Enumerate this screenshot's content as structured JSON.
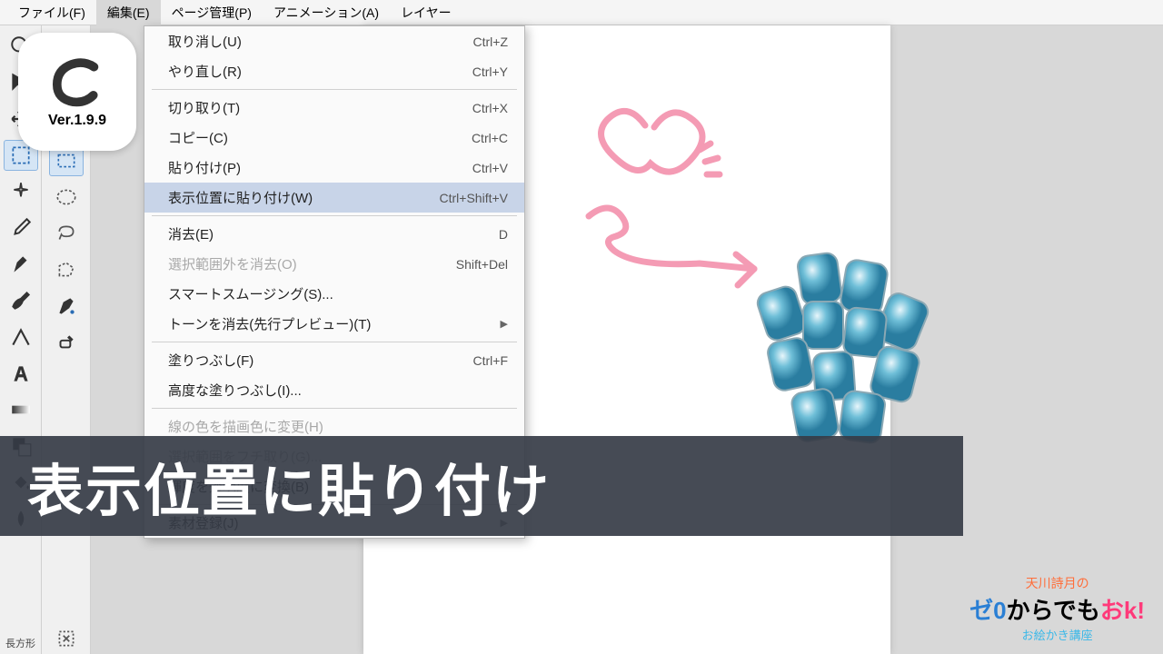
{
  "menubar": [
    {
      "label": "ファイル(F)"
    },
    {
      "label": "編集(E)",
      "active": true
    },
    {
      "label": "ページ管理(P)"
    },
    {
      "label": "アニメーション(A)"
    },
    {
      "label": "レイヤー"
    }
  ],
  "logo": {
    "version": "Ver.1.9.9"
  },
  "dropdown": [
    {
      "type": "item",
      "label": "取り消し(U)",
      "shortcut": "Ctrl+Z"
    },
    {
      "type": "item",
      "label": "やり直し(R)",
      "shortcut": "Ctrl+Y"
    },
    {
      "type": "sep"
    },
    {
      "type": "item",
      "label": "切り取り(T)",
      "shortcut": "Ctrl+X"
    },
    {
      "type": "item",
      "label": "コピー(C)",
      "shortcut": "Ctrl+C"
    },
    {
      "type": "item",
      "label": "貼り付け(P)",
      "shortcut": "Ctrl+V"
    },
    {
      "type": "item",
      "label": "表示位置に貼り付け(W)",
      "shortcut": "Ctrl+Shift+V",
      "highlighted": true
    },
    {
      "type": "sep"
    },
    {
      "type": "item",
      "label": "消去(E)",
      "shortcut": "D"
    },
    {
      "type": "item",
      "label": "選択範囲外を消去(O)",
      "shortcut": "Shift+Del",
      "disabled": true
    },
    {
      "type": "item",
      "label": "スマートスムージング(S)...",
      "shortcut": ""
    },
    {
      "type": "item",
      "label": "トーンを消去(先行プレビュー)(T)",
      "shortcut": "",
      "submenu": true
    },
    {
      "type": "sep"
    },
    {
      "type": "item",
      "label": "塗りつぶし(F)",
      "shortcut": "Ctrl+F"
    },
    {
      "type": "item",
      "label": "高度な塗りつぶし(I)...",
      "shortcut": ""
    },
    {
      "type": "sep"
    },
    {
      "type": "item",
      "label": "線の色を描画色に変更(H)",
      "shortcut": "",
      "faded": true
    },
    {
      "type": "item",
      "label": "選択範囲をフチ取り(G)...",
      "shortcut": "",
      "faded": true
    },
    {
      "type": "item",
      "label": "輝度を透明度に変換(B)",
      "shortcut": ""
    },
    {
      "type": "sep"
    },
    {
      "type": "item",
      "label": "素材登録(J)",
      "shortcut": "",
      "submenu": true
    }
  ],
  "banner": {
    "text": "表示位置に貼り付け"
  },
  "tool_label": "長方形",
  "series_logo": {
    "line1": "天川詩月の",
    "line2_a": "ゼ0",
    "line2_b": "からでも",
    "line2_c": "おk!",
    "line3": "お絵かき講座"
  }
}
